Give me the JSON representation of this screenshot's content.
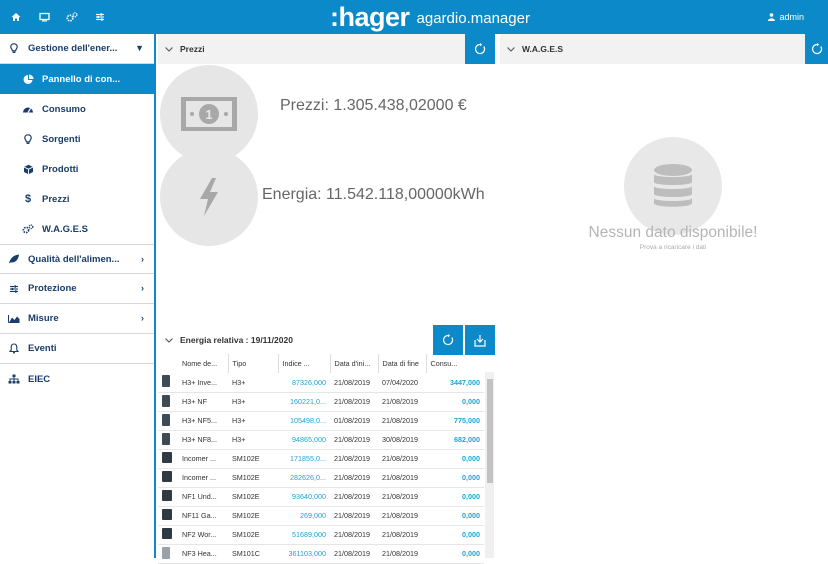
{
  "topbar": {
    "brand_logo": ":hager",
    "brand_product": "agardio.manager",
    "user": "admin",
    "icons": [
      "home-icon",
      "monitor-icon",
      "settings-icon",
      "sliders-icon"
    ]
  },
  "sidebar": {
    "items": [
      {
        "label": "Gestione dell'ener...",
        "icon": "bulb-icon",
        "level": "top",
        "arrow": "down"
      },
      {
        "label": "Pannello di con...",
        "icon": "pie-icon",
        "level": "sub",
        "active": true
      },
      {
        "label": "Consumo",
        "icon": "gauge-icon",
        "level": "sub"
      },
      {
        "label": "Sorgenti",
        "icon": "bulb-icon",
        "level": "sub"
      },
      {
        "label": "Prodotti",
        "icon": "box-icon",
        "level": "sub"
      },
      {
        "label": "Prezzi",
        "icon": "dollar-icon",
        "level": "sub"
      },
      {
        "label": "W.A.G.E.S",
        "icon": "gears-icon",
        "level": "sub"
      },
      {
        "label": "Qualità dell'alimen...",
        "icon": "leaf-icon",
        "level": "top",
        "arrow": "right"
      },
      {
        "label": "Protezione",
        "icon": "sliders-icon",
        "level": "top",
        "arrow": "right"
      },
      {
        "label": "Misure",
        "icon": "area-chart-icon",
        "level": "top",
        "arrow": "right"
      },
      {
        "label": "Eventi",
        "icon": "bell-icon",
        "level": "top"
      },
      {
        "label": "EIEC",
        "icon": "network-icon",
        "level": "top"
      }
    ]
  },
  "prezzi_panel": {
    "title": "Prezzi",
    "price_text": "Prezzi: 1.305.438,02000 €",
    "energy_text": "Energia: 11.542.118,00000kWh"
  },
  "wages_panel": {
    "title": "W.A.G.E.S",
    "no_data": "Nessun dato disponibile!",
    "no_data_sub": "Prova a ricaricare i dati"
  },
  "energy_panel": {
    "title": "Energia relativa : 19/11/2020",
    "columns": [
      "Nome de...",
      "Tipo",
      "Indice ...",
      "Data d'ini...",
      "Data di fine",
      "Consu..."
    ],
    "rows": [
      {
        "icon": "dark",
        "name": "H3+ Inve...",
        "tipo": "H3+",
        "indice": "87326,000",
        "start": "21/08/2019",
        "end": "07/04/2020",
        "cons": "3447,000"
      },
      {
        "icon": "dark",
        "name": "H3+ NF",
        "tipo": "H3+",
        "indice": "160221,0...",
        "start": "21/08/2019",
        "end": "21/08/2019",
        "cons": "0,000"
      },
      {
        "icon": "dark",
        "name": "H3+ NF5...",
        "tipo": "H3+",
        "indice": "105498,0...",
        "start": "01/08/2019",
        "end": "21/08/2019",
        "cons": "775,000"
      },
      {
        "icon": "dark",
        "name": "H3+ NF8...",
        "tipo": "H3+",
        "indice": "94865,000",
        "start": "21/08/2019",
        "end": "30/08/2019",
        "cons": "682,000"
      },
      {
        "icon": "wide",
        "name": "Incomer ...",
        "tipo": "SM102E",
        "indice": "171855,0...",
        "start": "21/08/2019",
        "end": "21/08/2019",
        "cons": "0,000"
      },
      {
        "icon": "wide",
        "name": "Incomer ...",
        "tipo": "SM102E",
        "indice": "282626,0...",
        "start": "21/08/2019",
        "end": "21/08/2019",
        "cons": "0,000"
      },
      {
        "icon": "wide",
        "name": "NF1 Und...",
        "tipo": "SM102E",
        "indice": "93640,000",
        "start": "21/08/2019",
        "end": "21/08/2019",
        "cons": "0,000"
      },
      {
        "icon": "wide",
        "name": "NF11 Ga...",
        "tipo": "SM102E",
        "indice": "269,000",
        "start": "21/08/2019",
        "end": "21/08/2019",
        "cons": "0,000"
      },
      {
        "icon": "wide",
        "name": "NF2 Wor...",
        "tipo": "SM102E",
        "indice": "51689,000",
        "start": "21/08/2019",
        "end": "21/08/2019",
        "cons": "0,000"
      },
      {
        "icon": "lite",
        "name": "NF3 Hea...",
        "tipo": "SM101C",
        "indice": "361103,000",
        "start": "21/08/2019",
        "end": "21/08/2019",
        "cons": "0,000"
      }
    ]
  },
  "colors": {
    "accent": "#0b89c8",
    "value": "#1da3d6",
    "text": "#1a3d6a"
  }
}
